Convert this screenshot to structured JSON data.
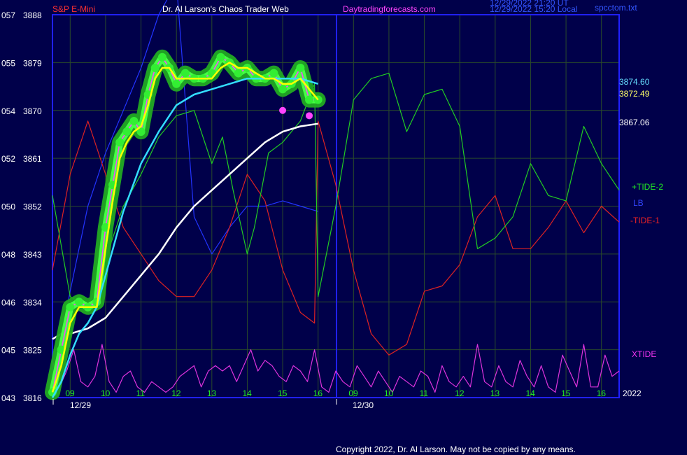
{
  "header": {
    "symbol": "S&P E-Mini",
    "title": "Dr. Al Larson's Chaos Trader Web",
    "site": "Daytradingforecasts.com",
    "time_ut": "12/29/2022 21:20 UT",
    "time_local": "12/29/2022 15:20 Local",
    "file": "spcctom.txt"
  },
  "copyright": "Copyright 2022, Dr. Al Larson. May not be copied by any means.",
  "colors": {
    "background": "#00004a",
    "border": "#2020ff",
    "grid": "#2a4a2a",
    "price": "#00ff00",
    "glow": "#22aa22",
    "yellow": "#ffff00",
    "magenta": "#ff44ff",
    "cyan": "#33ddff",
    "white": "#ffffff",
    "tide2": "#22cc22",
    "tide1": "#dd2222",
    "lb": "#2233ff",
    "xtide": "#dd33dd"
  },
  "chart_data": {
    "type": "line",
    "y_axis": {
      "ticks": [
        {
          "left": "043",
          "right": "3816"
        },
        {
          "left": "045",
          "right": "3825"
        },
        {
          "left": "046",
          "right": "3834"
        },
        {
          "left": "048",
          "right": "3843"
        },
        {
          "left": "050",
          "right": "3852"
        },
        {
          "left": "052",
          "right": "3861"
        },
        {
          "left": "054",
          "right": "3870"
        },
        {
          "left": "055",
          "right": "3879"
        },
        {
          "left": "057",
          "right": "3888"
        }
      ],
      "ylim": [
        3816,
        3888
      ]
    },
    "x_axis": {
      "hour_ticks": [
        "09",
        "10",
        "11",
        "12",
        "13",
        "14",
        "15",
        "16",
        "09",
        "10",
        "11",
        "12",
        "13",
        "14",
        "15",
        "16"
      ],
      "date_labels": [
        "12/29",
        "12/30"
      ],
      "year_label": "2022",
      "xlim": [
        8.5,
        24.5
      ]
    },
    "price_labels": [
      "3874.60",
      "3872.49",
      "3867.06"
    ],
    "series": [
      {
        "name": "S&P E-Mini",
        "kind": "price",
        "x": [
          8.5,
          8.75,
          9.0,
          9.25,
          9.5,
          9.75,
          10.0,
          10.2,
          10.4,
          10.6,
          10.8,
          11.0,
          11.2,
          11.4,
          11.6,
          11.8,
          12.0,
          12.25,
          12.5,
          12.75,
          13.0,
          13.25,
          13.5,
          13.75,
          14.0,
          14.25,
          14.5,
          14.75,
          15.0,
          15.25,
          15.5,
          15.75,
          16.0
        ],
        "y": [
          3817,
          3825,
          3833,
          3834,
          3833,
          3834,
          3848,
          3856,
          3864,
          3866,
          3868,
          3866,
          3873,
          3878,
          3880,
          3878,
          3875,
          3877,
          3876,
          3876,
          3877,
          3880,
          3879,
          3877,
          3878,
          3876,
          3876,
          3877,
          3874,
          3875,
          3878,
          3872,
          3872
        ]
      },
      {
        "name": "yellow-avg",
        "kind": "avg",
        "x": [
          8.5,
          8.75,
          9.0,
          9.25,
          9.5,
          9.75,
          10.0,
          10.2,
          10.4,
          10.6,
          10.8,
          11.0,
          11.2,
          11.4,
          11.6,
          11.8,
          12.0,
          12.25,
          12.5,
          12.75,
          13.0,
          13.25,
          13.5,
          13.75,
          14.0,
          14.25,
          14.5,
          14.75,
          15.0,
          15.25,
          15.5,
          15.75,
          16.0
        ],
        "y": [
          3817,
          3822,
          3830,
          3833,
          3833,
          3833,
          3844,
          3853,
          3861,
          3864,
          3866,
          3867,
          3871,
          3876,
          3878,
          3878,
          3876,
          3876,
          3876,
          3876,
          3876,
          3878,
          3879,
          3878,
          3878,
          3877,
          3876,
          3876,
          3875,
          3875,
          3876,
          3874,
          3872
        ]
      },
      {
        "name": "cyan-avg",
        "kind": "avg",
        "x": [
          8.5,
          8.75,
          9.0,
          9.25,
          9.5,
          9.75,
          10.0,
          10.5,
          11.0,
          11.5,
          12.0,
          12.5,
          13.0,
          13.5,
          14.0,
          14.5,
          15.0,
          15.5,
          16.0
        ],
        "y": [
          3816,
          3819,
          3824,
          3828,
          3830,
          3833,
          3839,
          3851,
          3860,
          3866,
          3871,
          3873,
          3874,
          3875,
          3876,
          3876,
          3876,
          3876,
          3875
        ]
      },
      {
        "name": "white-avg",
        "kind": "avg",
        "x": [
          8.5,
          8.75,
          9.0,
          9.5,
          10.0,
          10.5,
          11.0,
          11.5,
          12.0,
          12.5,
          13.0,
          13.5,
          14.0,
          14.5,
          15.0,
          15.5,
          16.0
        ],
        "y": [
          3827,
          3828,
          3828,
          3829,
          3831,
          3835,
          3839,
          3843,
          3848,
          3852,
          3855,
          3858,
          3861,
          3864,
          3866,
          3867,
          3867.5
        ]
      },
      {
        "name": "+TIDE-2",
        "kind": "tide",
        "x": [
          8.5,
          9.0,
          9.5,
          10.0,
          10.5,
          11.0,
          11.5,
          12.0,
          12.5,
          13.0,
          13.3,
          13.6,
          14.0,
          14.2,
          14.6,
          15.0,
          15.5,
          15.9,
          16.0,
          16.5,
          17.0,
          17.5,
          18.0,
          18.5,
          19.0,
          19.5,
          20.0,
          20.5,
          21.0,
          21.5,
          22.0,
          22.5,
          23.0,
          23.5,
          24.0,
          24.5
        ],
        "y": [
          3854,
          3835,
          3833,
          3842,
          3852,
          3858,
          3865,
          3869,
          3870,
          3860,
          3865,
          3855,
          3843,
          3848,
          3862,
          3864,
          3868,
          3875,
          3835,
          3852,
          3872,
          3876,
          3877,
          3866,
          3873,
          3874,
          3867,
          3844,
          3846,
          3850,
          3860,
          3854,
          3853,
          3867,
          3860,
          3855
        ]
      },
      {
        "name": "-TIDE-1",
        "kind": "tide",
        "x": [
          8.5,
          9.0,
          9.5,
          10.0,
          10.5,
          11.0,
          11.5,
          12.0,
          12.5,
          13.0,
          13.5,
          14.0,
          14.5,
          15.0,
          15.5,
          15.9,
          16.0,
          16.5,
          17.0,
          17.5,
          18.0,
          18.5,
          19.0,
          19.5,
          20.0,
          20.5,
          21.0,
          21.5,
          22.0,
          22.5,
          23.0,
          23.5,
          24.0,
          24.5
        ],
        "y": [
          3840,
          3858,
          3868,
          3858,
          3848,
          3843,
          3838,
          3835,
          3835,
          3840,
          3848,
          3858,
          3853,
          3840,
          3832,
          3830,
          3868,
          3856,
          3840,
          3828,
          3824,
          3826,
          3836,
          3837,
          3841,
          3850,
          3854,
          3844,
          3844,
          3848,
          3853,
          3847,
          3852,
          3849
        ]
      },
      {
        "name": "LB",
        "kind": "tide",
        "x": [
          8.5,
          9.0,
          9.5,
          10.0,
          10.5,
          11.0,
          11.5,
          12.0,
          12.5,
          13.0,
          13.5,
          14.0,
          14.5,
          15.0,
          15.5,
          16.0
        ],
        "y": [
          3819,
          3836,
          3852,
          3862,
          3870,
          3878,
          3888,
          3894,
          3850,
          3843,
          3848,
          3852,
          3852,
          3853,
          3852,
          3851
        ]
      },
      {
        "name": "XTIDE",
        "kind": "xtide",
        "x": [
          8.5,
          8.7,
          8.9,
          9.1,
          9.3,
          9.5,
          9.7,
          9.9,
          10.1,
          10.3,
          10.5,
          10.7,
          10.9,
          11.1,
          11.3,
          11.5,
          11.7,
          11.9,
          12.1,
          12.3,
          12.5,
          12.7,
          12.9,
          13.1,
          13.3,
          13.5,
          13.7,
          13.9,
          14.1,
          14.3,
          14.5,
          14.7,
          14.9,
          15.1,
          15.3,
          15.5,
          15.7,
          15.9,
          16.1,
          16.3,
          16.5,
          16.7,
          16.9,
          17.1,
          17.3,
          17.5,
          17.7,
          17.9,
          18.1,
          18.3,
          18.5,
          18.7,
          18.9,
          19.1,
          19.3,
          19.5,
          19.7,
          19.9,
          20.1,
          20.3,
          20.5,
          20.7,
          20.9,
          21.1,
          21.3,
          21.5,
          21.7,
          21.9,
          22.1,
          22.3,
          22.5,
          22.7,
          22.9,
          23.1,
          23.3,
          23.5,
          23.7,
          23.9,
          24.1,
          24.3,
          24.5
        ],
        "y": [
          3823,
          3818,
          3821,
          3825,
          3819,
          3818,
          3820,
          3826,
          3819,
          3817,
          3820,
          3821,
          3818,
          3817,
          3819,
          3818,
          3817,
          3818,
          3820,
          3821,
          3822,
          3818,
          3821,
          3822,
          3821,
          3822,
          3819,
          3822,
          3825,
          3821,
          3823,
          3822,
          3820,
          3819,
          3822,
          3821,
          3819,
          3825,
          3818,
          3817,
          3821,
          3819,
          3818,
          3822,
          3820,
          3818,
          3821,
          3819,
          3817,
          3820,
          3819,
          3818,
          3821,
          3820,
          3817,
          3822,
          3819,
          3818,
          3820,
          3818,
          3826,
          3819,
          3818,
          3822,
          3819,
          3818,
          3823,
          3820,
          3818,
          3822,
          3818,
          3817,
          3824,
          3821,
          3818,
          3826,
          3818,
          3818,
          3824,
          3820,
          3821
        ]
      }
    ],
    "markers": [
      {
        "x": 15.0,
        "y": 3870,
        "color": "magenta"
      },
      {
        "x": 15.75,
        "y": 3869,
        "color": "magenta"
      }
    ],
    "legend": [
      "+TIDE-2",
      "LB",
      "-TIDE-1",
      "XTIDE"
    ]
  }
}
